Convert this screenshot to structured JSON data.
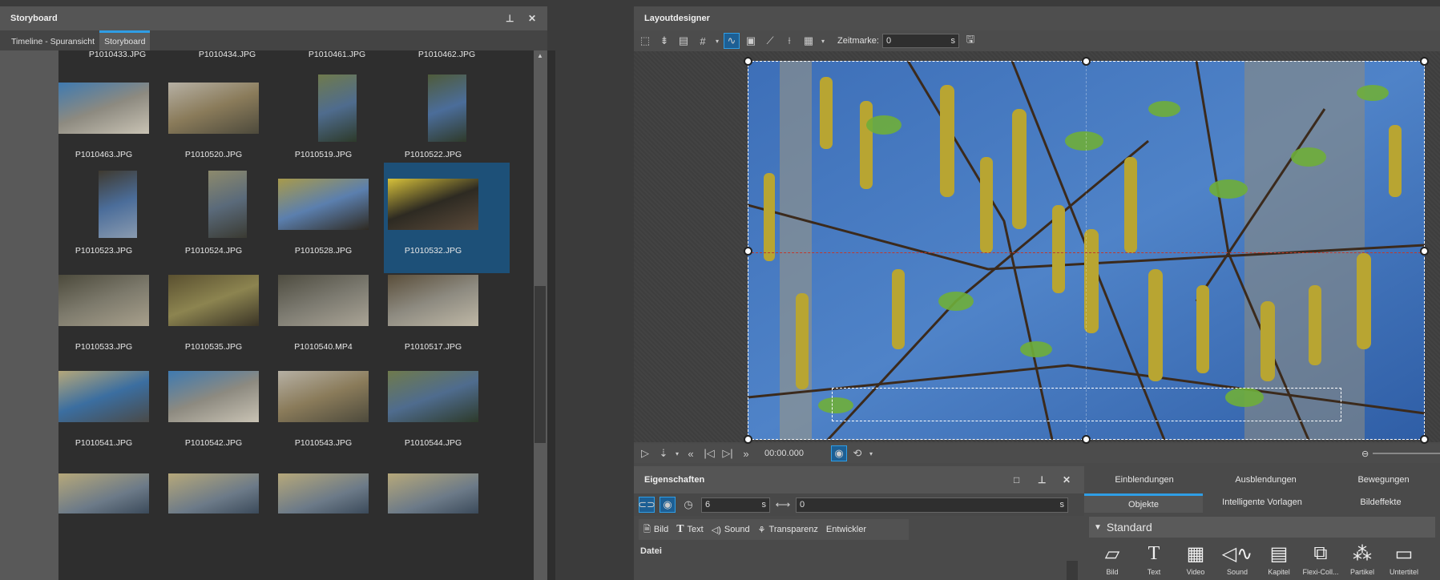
{
  "storyboard": {
    "title": "Storyboard",
    "tabs": [
      {
        "label": "Timeline - Spuransicht"
      },
      {
        "label": "Storyboard"
      }
    ],
    "top_labels": [
      "P1010433.JPG",
      "P1010434.JPG",
      "P1010461.JPG",
      "P1010462.JPG"
    ],
    "rows": [
      [
        "P1010463.JPG",
        "P1010520.JPG",
        "P1010519.JPG",
        "P1010522.JPG"
      ],
      [
        "P1010523.JPG",
        "P1010524.JPG",
        "P1010528.JPG",
        "P1010532.JPG"
      ],
      [
        "P1010533.JPG",
        "P1010535.JPG",
        "P1010540.MP4",
        "P1010517.JPG"
      ],
      [
        "P1010541.JPG",
        "P1010542.JPG",
        "P1010543.JPG",
        "P1010544.JPG"
      ]
    ],
    "selected": "P1010532.JPG"
  },
  "layoutdesigner": {
    "title": "Layoutdesigner",
    "zeitmarke_label": "Zeitmarke:",
    "zeitmarke_value": "0",
    "zeitmarke_unit": "s",
    "time": "00:00.000"
  },
  "eigenschaften": {
    "title": "Eigenschaften",
    "duration_value": "6",
    "duration_unit": "s",
    "offset_value": "0",
    "offset_unit": "s",
    "tabs": [
      "Bild",
      "Text",
      "Sound",
      "Transparenz",
      "Entwickler"
    ],
    "datei_label": "Datei"
  },
  "objects_panel": {
    "tabs_top": [
      "Einblendungen",
      "Ausblendungen",
      "Bewegungen"
    ],
    "tabs_bottom": [
      "Objekte",
      "Intelligente Vorlagen",
      "Bildeffekte"
    ],
    "section": "Standard",
    "items": [
      "Bild",
      "Text",
      "Video",
      "Sound",
      "Kapitel",
      "Flexi-Coll...",
      "Partikel",
      "Untertitel"
    ]
  },
  "colors": {
    "accent": "#2f9ee6",
    "selection": "#1d5078"
  }
}
